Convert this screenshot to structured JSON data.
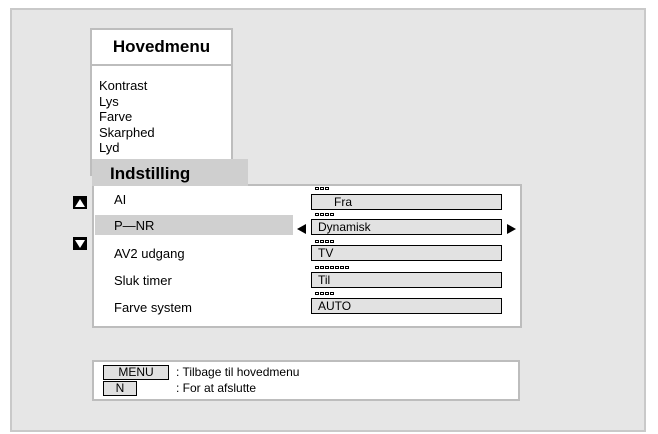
{
  "main_menu": {
    "title": "Hovedmenu",
    "items": [
      "Kontrast",
      "Lys",
      "Farve",
      "Skarphed",
      "Lyd"
    ]
  },
  "submenu": {
    "title": "Indstilling",
    "rows": [
      {
        "label": "AI",
        "value": "Fra",
        "squares": 3
      },
      {
        "label": "P—NR",
        "value": "Dynamisk",
        "squares": 4,
        "selected": true
      },
      {
        "label": "AV2 udgang",
        "value": "TV",
        "squares": 4
      },
      {
        "label": "Sluk timer",
        "value": "Til",
        "squares": 7
      },
      {
        "label": "Farve system",
        "value": "AUTO",
        "squares": 4
      }
    ]
  },
  "help": {
    "menu_key": "MENU",
    "menu_text": ": Tilbage til hovedmenu",
    "n_key": "N",
    "n_text": ": For at afslutte"
  },
  "icons": {
    "up": "up-arrow-icon",
    "down": "down-arrow-icon",
    "left": "left-arrow-icon",
    "right": "right-arrow-icon"
  }
}
